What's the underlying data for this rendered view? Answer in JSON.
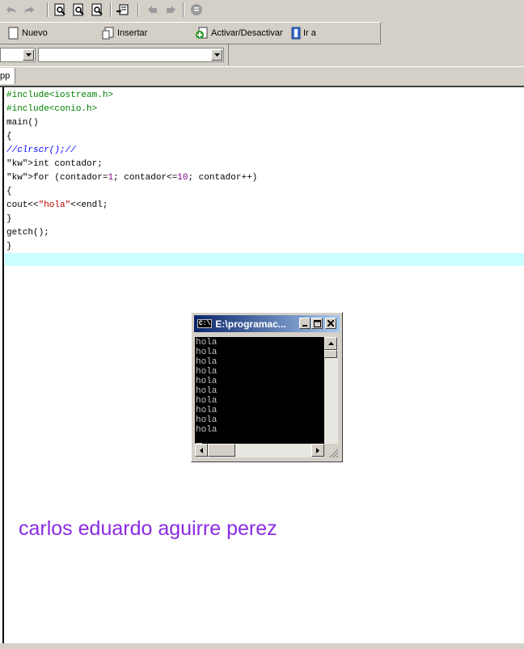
{
  "toolbar": {
    "nuevo_label": "Nuevo",
    "insertar_label": "Insertar",
    "activar_label": "Activar/Desactivar",
    "ira_label": "Ir a"
  },
  "combos": {
    "first_value": "",
    "second_value": ""
  },
  "tabs": [
    {
      "label": "pp"
    }
  ],
  "code_lines": [
    "#include<iostream.h>",
    "#include<conio.h>",
    "main()",
    "{",
    "//clrscr();//",
    "int contador;",
    "for (contador=1; contador<=10; contador++)",
    "{",
    "cout<<\"hola\"<<endl;",
    "}",
    "getch();",
    "}"
  ],
  "console": {
    "title": "E:\\programac...",
    "icon_text": "C:\\",
    "lines": [
      "hola",
      "hola",
      "hola",
      "hola",
      "hola",
      "hola",
      "hola",
      "hola",
      "hola",
      "hola"
    ]
  },
  "signature": "carlos eduardo aguirre perez",
  "colors": {
    "highlight_line": "#ccffff",
    "signature": "#8b2be2",
    "title_bar": "#0a246a"
  }
}
